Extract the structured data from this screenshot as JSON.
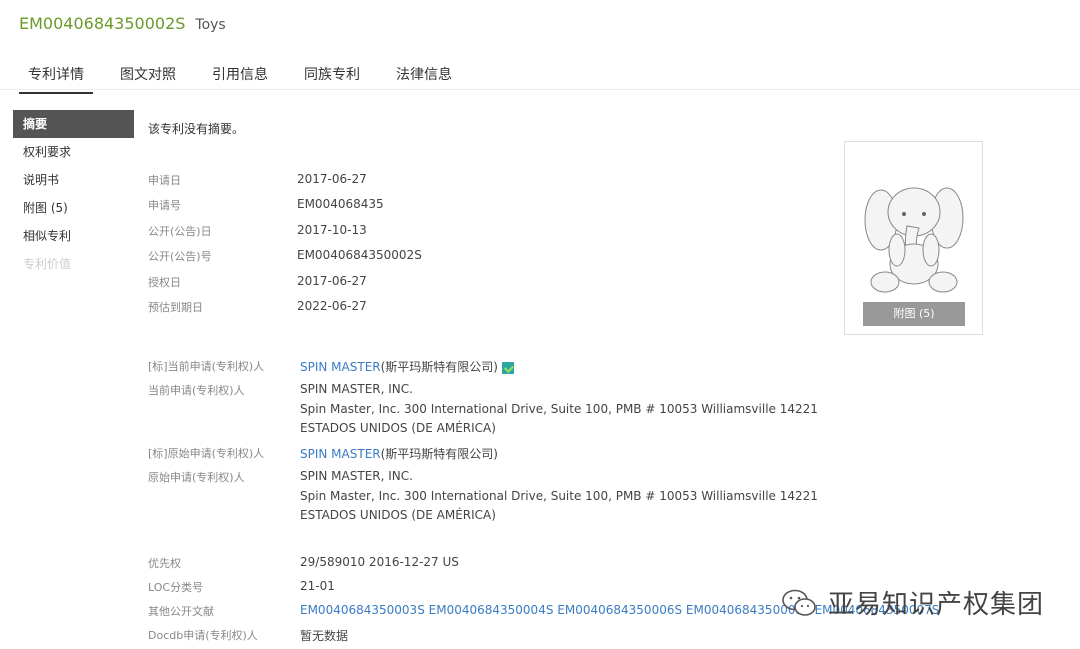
{
  "header": {
    "patent_number": "EM0040684350002S",
    "patent_name": "Toys"
  },
  "tabs": [
    {
      "label": "专利详情",
      "active": true
    },
    {
      "label": "图文对照",
      "active": false
    },
    {
      "label": "引用信息",
      "active": false
    },
    {
      "label": "同族专利",
      "active": false
    },
    {
      "label": "法律信息",
      "active": false
    }
  ],
  "sidebar": {
    "items": [
      {
        "label": "摘要",
        "state": "active"
      },
      {
        "label": "权利要求",
        "state": "normal"
      },
      {
        "label": "说明书",
        "state": "normal"
      },
      {
        "label": "附图 (5)",
        "state": "normal"
      },
      {
        "label": "相似专利",
        "state": "normal"
      },
      {
        "label": "专利价值",
        "state": "disabled"
      }
    ]
  },
  "main": {
    "no_abstract": "该专利没有摘要。",
    "dates": {
      "application_date_label": "申请日",
      "application_date": "2017-06-27",
      "application_no_label": "申请号",
      "application_no": "EM004068435",
      "publication_date_label": "公开(公告)日",
      "publication_date": "2017-10-13",
      "publication_no_label": "公开(公告)号",
      "publication_no": "EM0040684350002S",
      "grant_date_label": "授权日",
      "grant_date": "2017-06-27",
      "expiry_date_label": "预估到期日",
      "expiry_date": "2022-06-27"
    },
    "applicants": {
      "std_current_label": "[标]当前申请(专利权)人",
      "std_current_link": "SPIN MASTER",
      "std_current_suffix": "(斯平玛斯特有限公司)",
      "current_label": "当前申请(专利权)人",
      "current_link": "SPIN MASTER, INC.",
      "current_addr1": "Spin Master, Inc. 300 International Drive, Suite 100, PMB # 10053 Williamsville 14221",
      "current_addr2": "ESTADOS UNIDOS (DE AMÉRICA)",
      "std_original_label": "[标]原始申请(专利权)人",
      "std_original_link": "SPIN MASTER",
      "std_original_suffix": "(斯平玛斯特有限公司)",
      "original_label": "原始申请(专利权)人",
      "original_link": "SPIN MASTER, INC.",
      "original_addr1": "Spin Master, Inc. 300 International Drive, Suite 100, PMB # 10053 Williamsville 14221",
      "original_addr2": "ESTADOS UNIDOS (DE AMÉRICA)"
    },
    "other": {
      "priority_label": "优先权",
      "priority": "29/589010 2016-12-27 US",
      "loc_label": "LOC分类号",
      "loc": "21-01",
      "other_pub_label": "其他公开文献",
      "other_pubs": [
        "EM0040684350003S",
        "EM0040684350004S",
        "EM0040684350006S",
        "EM0040684350005S",
        "EM0040684350007S"
      ],
      "docdb_label": "Docdb申请(专利权)人",
      "docdb": "暂无数据"
    }
  },
  "thumbnail": {
    "button_label": "附图 (5)",
    "icon": "elephant-plush-image"
  },
  "watermark": {
    "text": "亚易知识产权集团",
    "icon": "wechat-icon"
  },
  "colors": {
    "patent_number": "#6a9a2a",
    "link": "#3a7cc4",
    "sidebar_active_bg": "#555555"
  }
}
